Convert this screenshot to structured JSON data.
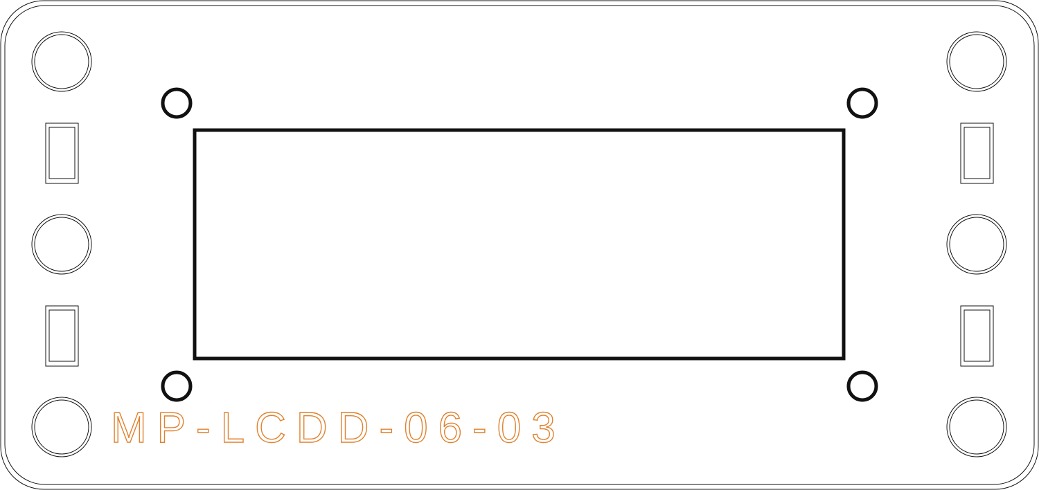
{
  "part_number": "MP-LCDD-06-03",
  "colors": {
    "outline": "#111111",
    "label": "#e0822e",
    "background": "#ffffff"
  }
}
